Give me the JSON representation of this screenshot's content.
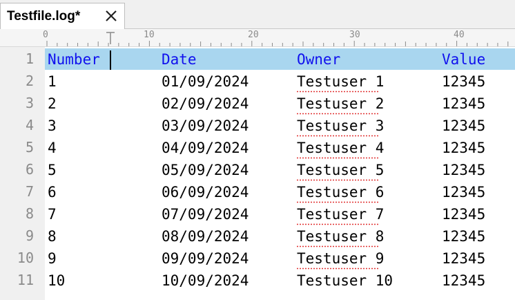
{
  "tab": {
    "title": "Testfile.log*",
    "close_icon": "close-icon"
  },
  "ruler": {
    "labels": [
      "0",
      "10",
      "20",
      "30",
      "40"
    ]
  },
  "gutter": {
    "line_numbers": [
      "1",
      "2",
      "3",
      "4",
      "5",
      "6",
      "7",
      "8",
      "9",
      "10",
      "11"
    ]
  },
  "table": {
    "header": {
      "number": "Number",
      "date": "Date",
      "owner": "Owner",
      "value": "Value"
    },
    "rows": [
      {
        "number": "1",
        "date": "01/09/2024",
        "owner": "Testuser 1",
        "value": "12345"
      },
      {
        "number": "2",
        "date": "02/09/2024",
        "owner": "Testuser 2",
        "value": "12345"
      },
      {
        "number": "3",
        "date": "03/09/2024",
        "owner": "Testuser 3",
        "value": "12345"
      },
      {
        "number": "4",
        "date": "04/09/2024",
        "owner": "Testuser 4",
        "value": "12345"
      },
      {
        "number": "5",
        "date": "05/09/2024",
        "owner": "Testuser 5",
        "value": "12345"
      },
      {
        "number": "6",
        "date": "06/09/2024",
        "owner": "Testuser 6",
        "value": "12345"
      },
      {
        "number": "7",
        "date": "07/09/2024",
        "owner": "Testuser 7",
        "value": "12345"
      },
      {
        "number": "8",
        "date": "08/09/2024",
        "owner": "Testuser 8",
        "value": "12345"
      },
      {
        "number": "9",
        "date": "09/09/2024",
        "owner": "Testuser 9",
        "value": "12345"
      },
      {
        "number": "10",
        "date": "10/09/2024",
        "owner": "Testuser 10",
        "value": "12345"
      }
    ]
  },
  "colors": {
    "header_text": "#1010ee",
    "current_line": "#a9d6ef",
    "spellcheck": "#e03030",
    "gutter_text": "#8a8a8a"
  }
}
